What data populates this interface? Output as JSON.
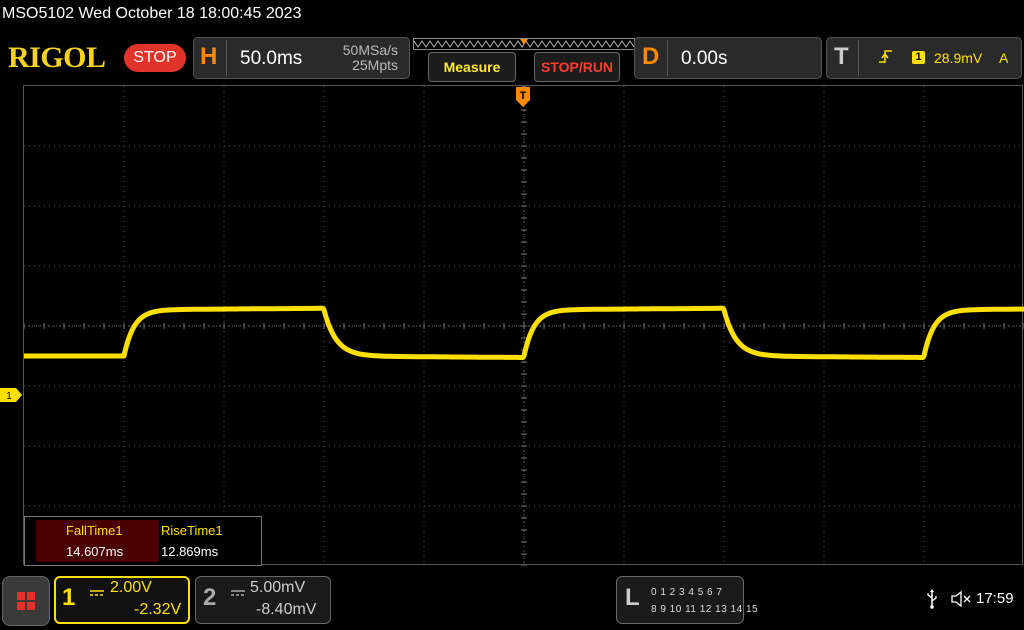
{
  "header": {
    "title": "MSO5102  Wed October 18 18:00:45 2023",
    "logo": "RIGOL",
    "status": "STOP"
  },
  "horizontal": {
    "letter": "H",
    "timebase": "50.0ms",
    "sample_rate": "50MSa/s",
    "memory_depth": "25Mpts"
  },
  "buttons": {
    "measure": "Measure",
    "stop_run": "STOP/RUN"
  },
  "delay": {
    "letter": "D",
    "value": "0.00s"
  },
  "trigger": {
    "letter": "T",
    "channel": "1",
    "level": "28.9mV",
    "mode": "A"
  },
  "channel1_marker": "1",
  "trigger_marker": "T",
  "measurements": [
    {
      "label": "FallTime1",
      "value": "14.607ms"
    },
    {
      "label": "RiseTime1",
      "value": "12.869ms"
    }
  ],
  "channel1": {
    "number": "1",
    "scale": "2.00V",
    "offset": "-2.32V"
  },
  "channel2": {
    "number": "2",
    "scale": "5.00mV",
    "offset": "-8.40mV"
  },
  "logic": {
    "letter": "L",
    "row1": "0 1 2 3  4 5 6 7",
    "row2": "8 9 10 11 12 13 14 15"
  },
  "clock": "17:59",
  "colors": {
    "trace": "#ffe000",
    "accent": "#ff8a00",
    "stop": "#e0342b"
  },
  "waveform": {
    "period_divs": 4,
    "high_level": 0.27,
    "low_level": -0.5
  }
}
